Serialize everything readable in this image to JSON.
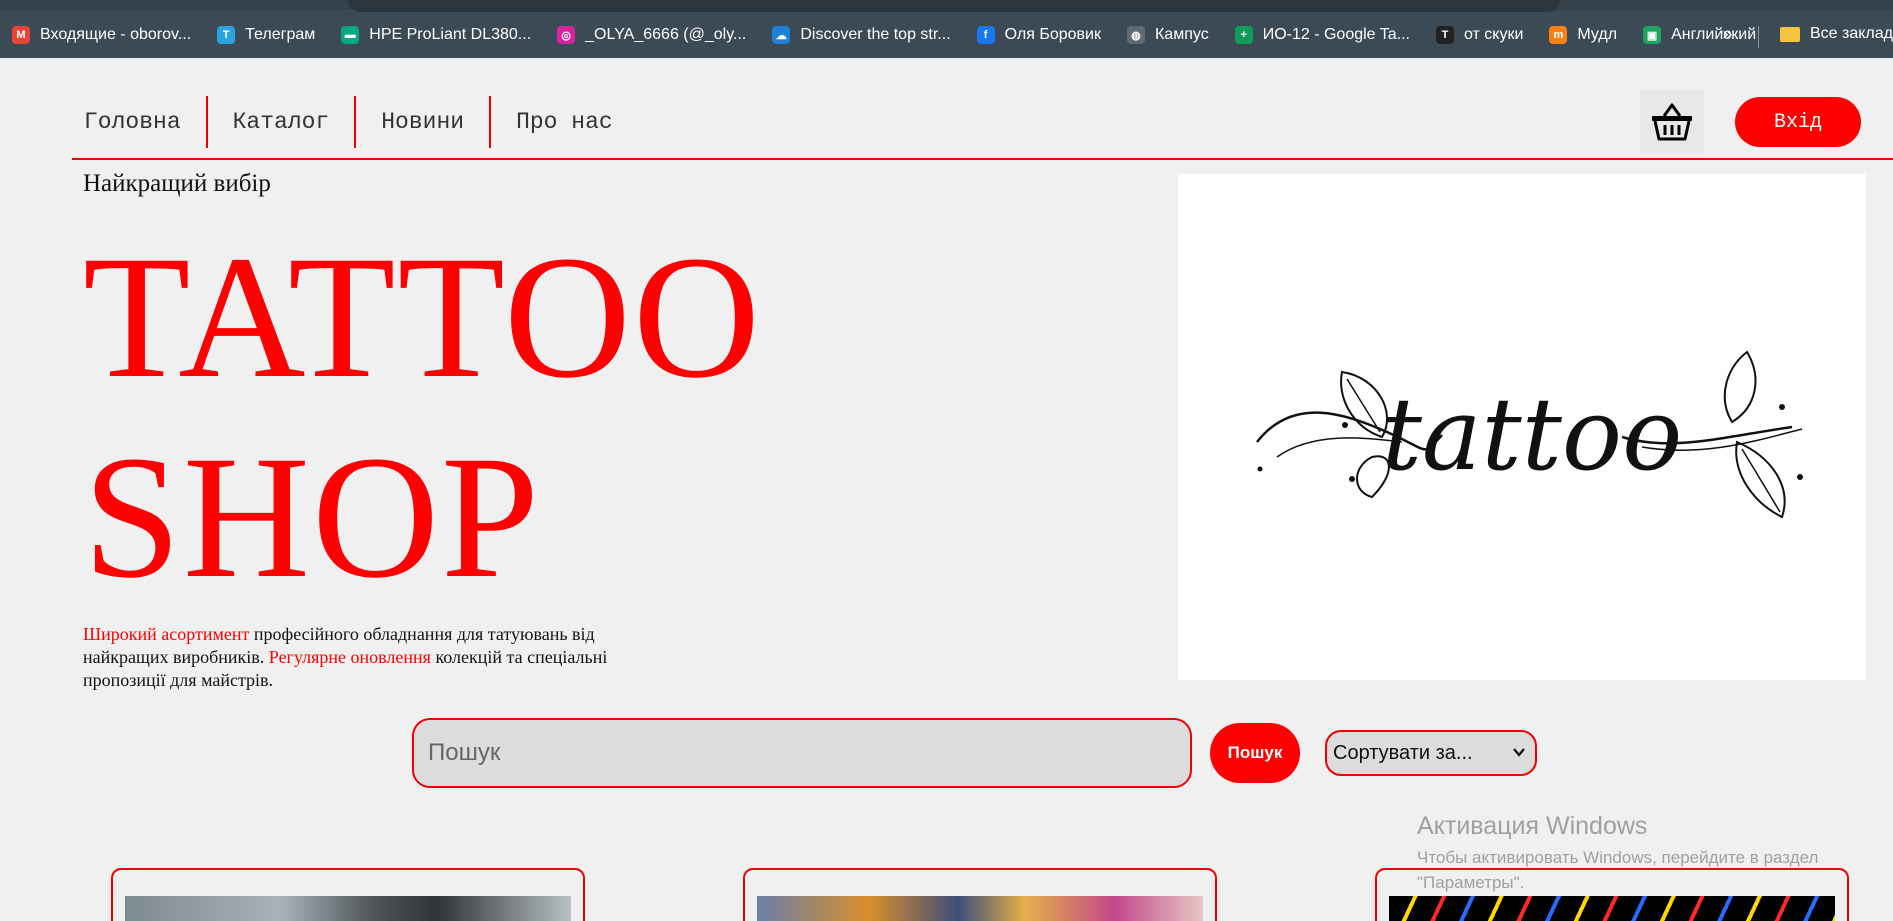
{
  "browser": {
    "bookmarks": [
      {
        "label": "Входящие - oborov...",
        "icon": "gmail-icon",
        "color": "#ea4335",
        "glyph": "M"
      },
      {
        "label": "Телеграм",
        "icon": "telegram-icon",
        "color": "#2aa3e0",
        "glyph": "T"
      },
      {
        "label": "HPE ProLiant DL380...",
        "icon": "hpe-icon",
        "color": "#01a982",
        "glyph": "▬"
      },
      {
        "label": "_OLYA_6666 (@_oly...",
        "icon": "instagram-icon",
        "color": "#d6249f",
        "glyph": "◎"
      },
      {
        "label": "Discover the top str...",
        "icon": "soundcloud-icon",
        "color": "#1e7fd6",
        "glyph": "☁"
      },
      {
        "label": "Оля Боровик",
        "icon": "facebook-icon",
        "color": "#1877f2",
        "glyph": "f"
      },
      {
        "label": "Кампус",
        "icon": "globe-icon",
        "color": "#5f6b73",
        "glyph": "◍"
      },
      {
        "label": "ИО-12 - Google Ta...",
        "icon": "google-sheets-icon",
        "color": "#0f9d58",
        "glyph": "+"
      },
      {
        "label": "от скуки",
        "icon": "tmobile-icon",
        "color": "#222",
        "glyph": "T"
      },
      {
        "label": "Мудл",
        "icon": "moodle-icon",
        "color": "#f98012",
        "glyph": "m"
      },
      {
        "label": "Английский",
        "icon": "classroom-icon",
        "color": "#1ea362",
        "glyph": "▣"
      }
    ],
    "more_glyph": "»",
    "folder_label": "Все закладки"
  },
  "nav": {
    "items": [
      "Головна",
      "Каталог",
      "Новини",
      "Про нас"
    ],
    "login_label": "Вхід"
  },
  "hero": {
    "tagline": "Найкращий вибір",
    "title_line1": "TATTOO",
    "title_line2": "SHOP",
    "image_text": "tattoo",
    "desc_red1": "Широкий асортимент",
    "desc_text1": " професійного обладнання для татуювань від найкращих виробників. ",
    "desc_red2": "Регулярне оновлення",
    "desc_text2": " колекцій та спеціальні пропозиції для майстрів."
  },
  "search": {
    "placeholder": "Пошук",
    "button_label": "Пошук",
    "sort_selected": "Сортувати за..."
  },
  "watermark": {
    "title": "Активация Windows",
    "text": "Чтобы активировать Windows, перейдите в раздел \"Параметры\"."
  },
  "colors": {
    "accent": "#ff0000",
    "background": "#f0f0f0"
  }
}
